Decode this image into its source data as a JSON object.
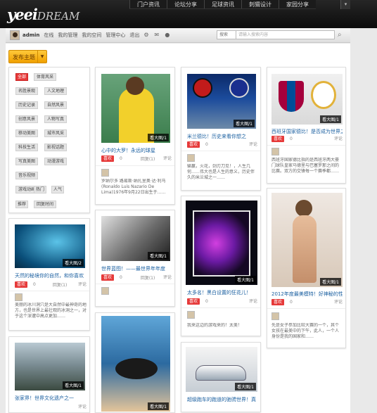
{
  "logo": {
    "part1": "yeei",
    "part2": "DREAM"
  },
  "topnav": {
    "items": [
      "门户资讯",
      "论坛分享",
      "足球资讯",
      "刺猬设计",
      "家园分享"
    ],
    "arrow": "▾"
  },
  "subbar": {
    "user": "admin",
    "links": [
      "在线",
      "我的管理",
      "我的空间",
      "管理中心",
      "退出"
    ],
    "search_select": "搜索",
    "search_placeholder": "请输入搜索内容"
  },
  "post_button": "发布主题",
  "tags": [
    "全部",
    "体育风采",
    "名胜景观",
    "人文地理",
    "历史记录",
    "自然风景",
    "创意风景",
    "人物写真",
    "移动美图",
    "城市风采",
    "科技生活",
    "影视话题",
    "写真美图",
    "动漫游戏",
    "音乐视频",
    "游戏动画",
    "影音",
    "热门",
    "人气",
    "推荐",
    "回复时间"
  ],
  "like_label": "喜欢",
  "comment_label": "评论",
  "cards": [
    {
      "badge": "看大图/1",
      "title": "心中的大罗！永远的球星",
      "like": "0",
      "replies": "回复(1)",
      "desc": "罗纳尔多 路易斯·纳扎里奥·达·利马(Ronaldo Luis Nazario De Lima)1976年9月22日出生于……"
    },
    {
      "badge": "看大图/1",
      "title": "米兰德比！历史来看你想之",
      "like": "0",
      "replies": "",
      "desc": "输赢，火花，剑刃刀见！，人生几何……伟大也是人生的意义，历史伴久的米兰城之一……"
    },
    {
      "badge": "看大图/1",
      "title": "西班牙国家德比！是否成为世界之最！",
      "like": "0",
      "replies": "",
      "desc": "西班牙国家德比指的是西班牙两大豪门球队皇家马德里与巴塞罗那之间的比赛。双方的交锋每一个赛季都……"
    },
    {
      "badge": "看大图/1",
      "title": "世界蓝图！——最世界年年度",
      "like": "0",
      "replies": "回复(1)",
      "desc": ""
    },
    {
      "badge": "看大图/2",
      "title": "天然的秘境你的自然，和你喜欢",
      "like": "0",
      "replies": "回复(1)",
      "desc": "美丽的冰川洞穴是大自然中最神奇的地方，也是世界上最壮观的冰洞之一，对于这个深邃中高点更加……"
    },
    {
      "badge": "看大图/1",
      "title": "太多名！黑白设置的狂花儿！",
      "like": "0",
      "replies": "",
      "desc": "我来这边的游戏来的！太美！"
    },
    {
      "badge": "看大图/1",
      "title": "2012年度最美模特！好神秘的性感",
      "like": "0",
      "replies": "",
      "desc": "先是女子参加比较大赛的一个，其个女孩在最美中的下午，此人，一个人身份是我的国家和……"
    },
    {
      "badge": "看大图/1",
      "title": "张家界！世界文化遗产之一",
      "like": "",
      "replies": "",
      "desc": ""
    },
    {
      "badge": "看大图/1",
      "title": "",
      "like": "",
      "replies": "",
      "desc": ""
    },
    {
      "badge": "看大图/1",
      "title": "超级跑车的跑道的驰骋世界！真的是一辆",
      "like": "",
      "replies": "",
      "desc": ""
    }
  ]
}
